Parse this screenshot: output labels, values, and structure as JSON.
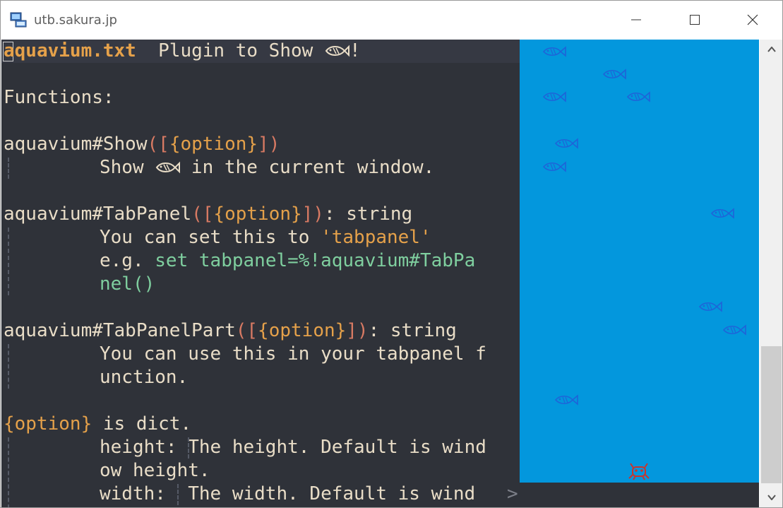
{
  "window": {
    "title": "utb.sakura.jp"
  },
  "editor": {
    "header": {
      "filename": "aquavium.txt",
      "tagline": "  Plugin to Show ",
      "tagline_end": "!"
    },
    "lines": {
      "functions": "Functions:",
      "show_sig_name": "aquavium#Show",
      "show_sig_args_open": "([",
      "show_sig_option": "{option}",
      "show_sig_args_close": "])",
      "show_desc_a": "Show ",
      "show_desc_b": " in the current window.",
      "tab_sig_name": "aquavium#TabPanel",
      "tab_sig_args_open": "([",
      "tab_sig_option": "{option}",
      "tab_sig_args_close": "])",
      "tab_sig_ret": ": string",
      "tab_desc1_a": "You can set this to ",
      "tab_desc1_b": "'tabpanel'",
      "tab_desc2_a": "e.g. ",
      "tab_desc2_b": "set tabpanel=%!aquavium#TabPa",
      "tab_desc3": "nel()",
      "part_sig_name": "aquavium#TabPanelPart",
      "part_sig_args_open": "([",
      "part_sig_option": "{option}",
      "part_sig_args_close": "])",
      "part_sig_ret": ": string",
      "part_desc1": "You can use this in your tabpanel f",
      "part_desc2": "unction.",
      "opt_a": "{option}",
      "opt_b": " is dict.",
      "height_a": "height:",
      "height_b": " The height. Default is wind",
      "height_c": "ow height.",
      "width_a": "width:",
      "width_b": "  The width. Default is wind",
      "fold": ">"
    }
  },
  "colors": {
    "editor_bg": "#2f3239",
    "aquarium_bg": "#0397dd",
    "fish": "#1f63d8",
    "crab": "#c8352d",
    "keyword": "#e5a14a",
    "code": "#7fcf9f"
  },
  "icons": [
    "app-icon",
    "fish-icon",
    "crab-icon",
    "minimize-icon",
    "maximize-icon",
    "close-icon",
    "scroll-up-icon",
    "scroll-down-icon"
  ]
}
